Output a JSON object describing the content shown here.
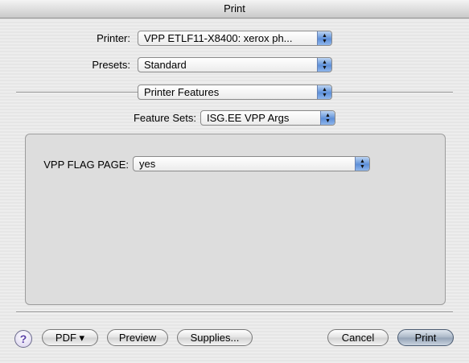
{
  "window": {
    "title": "Print"
  },
  "printer": {
    "label": "Printer:",
    "value": "VPP ETLF11-X8400: xerox ph..."
  },
  "presets": {
    "label": "Presets:",
    "value": "Standard"
  },
  "pane": {
    "value": "Printer Features"
  },
  "feature_sets": {
    "label": "Feature Sets:",
    "value": "ISG.EE VPP Args"
  },
  "vpp_flag_page": {
    "label": "VPP FLAG PAGE:",
    "value": "yes"
  },
  "buttons": {
    "help": "?",
    "pdf": "PDF ▾",
    "preview": "Preview",
    "supplies": "Supplies...",
    "cancel": "Cancel",
    "print": "Print"
  },
  "icons": {
    "popup_arrows": "up-down-arrows-icon",
    "help": "question-mark-icon"
  }
}
